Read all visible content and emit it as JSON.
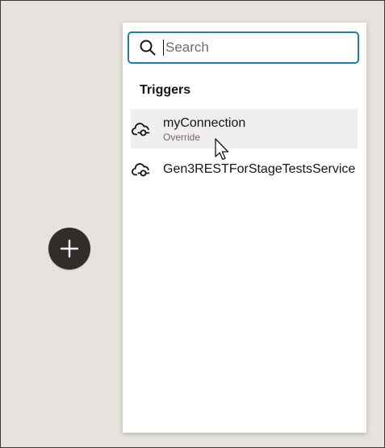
{
  "canvas": {
    "add_button_icon": "plus-icon"
  },
  "panel": {
    "search": {
      "placeholder": "Search",
      "value": "",
      "icon": "search-icon",
      "accent": "#227e9e"
    },
    "section_title": "Triggers",
    "items": [
      {
        "title": "myConnection",
        "subtitle": "Override",
        "icon": "cloud-connection-icon"
      },
      {
        "title": "Gen3RESTForStageTestsService",
        "icon": "cloud-connection-icon"
      }
    ]
  },
  "colors": {
    "background": "#e6e3de",
    "panel": "#ffffff",
    "button": "#312d2a",
    "hover": "#f1efed",
    "text": "#161513",
    "muted": "#6f6c69"
  }
}
